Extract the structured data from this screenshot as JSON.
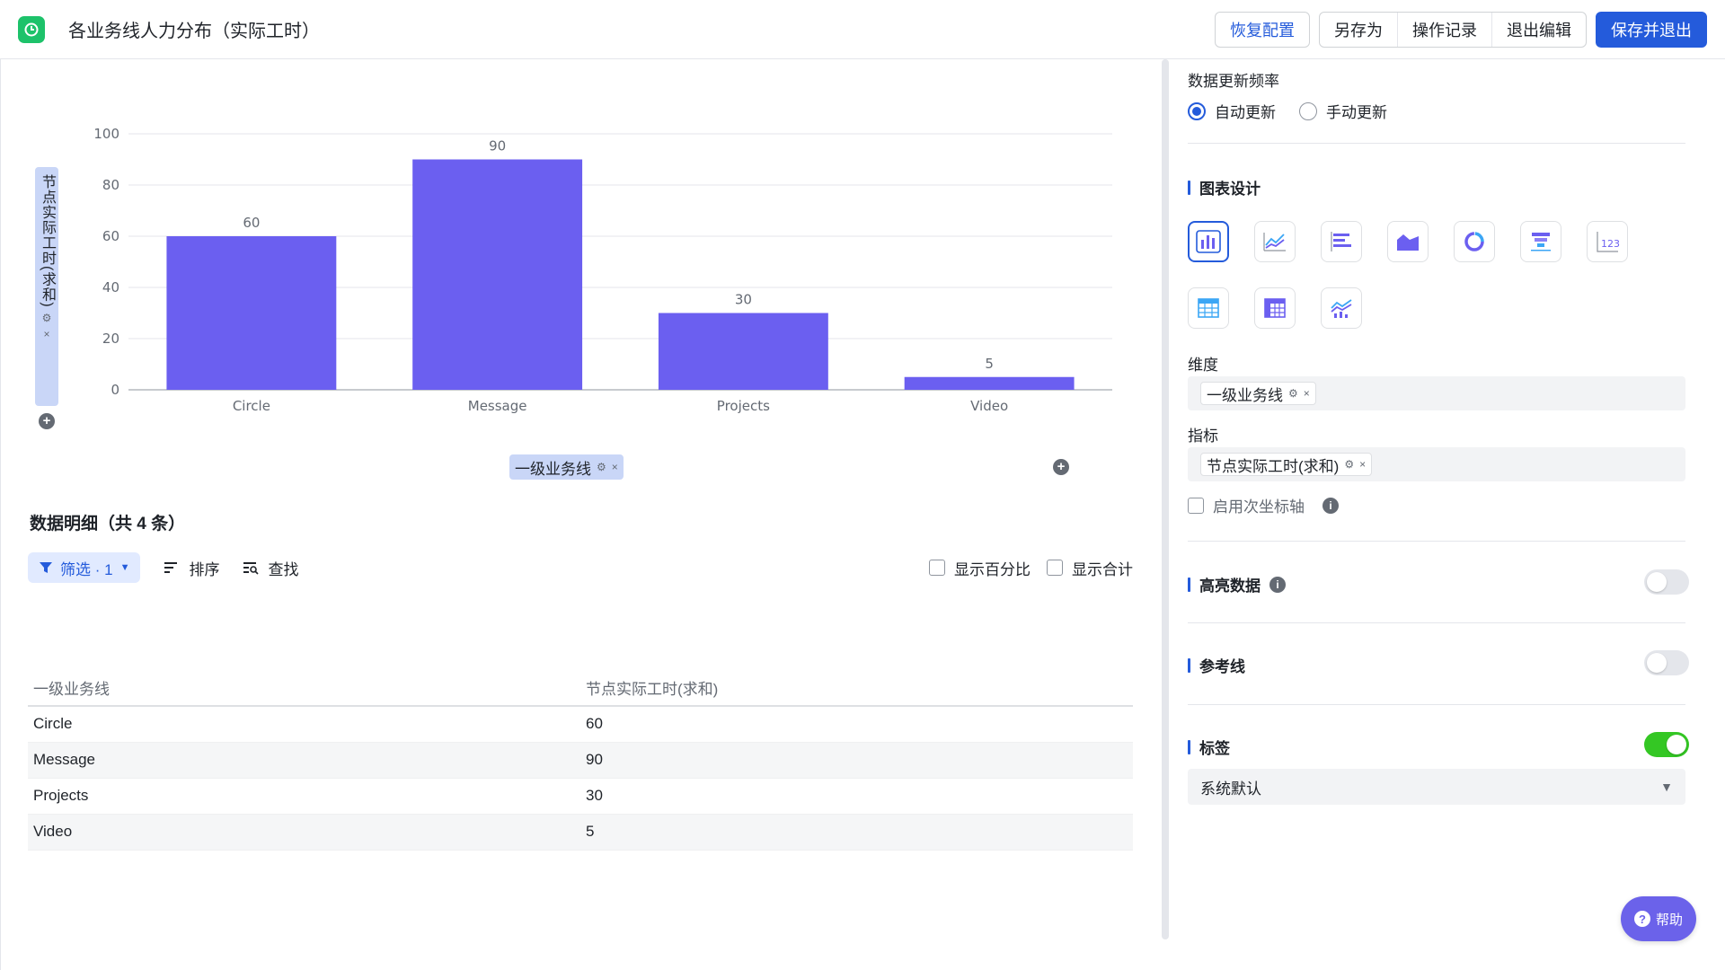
{
  "header": {
    "title": "各业务线人力分布（实际工时）",
    "restore_label": "恢复配置",
    "save_as_label": "另存为",
    "history_label": "操作记录",
    "exit_edit_label": "退出编辑",
    "save_exit_label": "保存并退出"
  },
  "chart": {
    "y_field": "节点实际工时(求和)",
    "x_field": "一级业务线",
    "settings_glyph": "⚙",
    "close_glyph": "×",
    "plus_glyph": "+"
  },
  "chart_data": {
    "type": "bar",
    "categories": [
      "Circle",
      "Message",
      "Projects",
      "Video"
    ],
    "values": [
      60,
      90,
      30,
      5
    ],
    "ylim": [
      0,
      100
    ],
    "yticks": [
      0,
      20,
      40,
      60,
      80,
      100
    ],
    "color": "#6b5ff0",
    "grid": true
  },
  "detail": {
    "title": "数据明细（共 4 条）",
    "filter_label": "筛选 · 1",
    "sort_label": "排序",
    "find_label": "查找",
    "show_percent_label": "显示百分比",
    "show_total_label": "显示合计",
    "columns": [
      "一级业务线",
      "节点实际工时(求和)"
    ],
    "rows": [
      [
        "Circle",
        "60"
      ],
      [
        "Message",
        "90"
      ],
      [
        "Projects",
        "30"
      ],
      [
        "Video",
        "5"
      ]
    ]
  },
  "settings": {
    "update_freq_label": "数据更新频率",
    "auto_update_label": "自动更新",
    "manual_update_label": "手动更新",
    "chart_design_label": "图表设计",
    "dimension_label": "维度",
    "dimension_value": "一级业务线",
    "metric_label": "指标",
    "metric_value": "节点实际工时(求和)",
    "secondary_axis_label": "启用次坐标轴",
    "highlight_label": "高亮数据",
    "refline_label": "参考线",
    "tag_label": "标签",
    "tag_select_value": "系统默认"
  },
  "help": {
    "label": "帮助"
  },
  "colors": {
    "accent": "#245bdb",
    "bar": "#6b5ff0",
    "toggle_on": "#34c724"
  }
}
